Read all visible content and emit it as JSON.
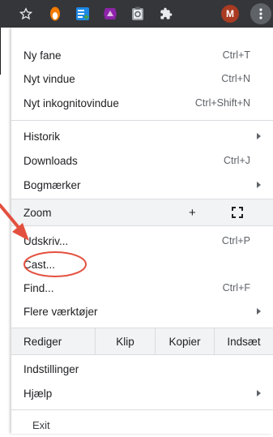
{
  "toolbar": {
    "icons": [
      "star-icon",
      "extension-orange-icon",
      "extension-list-icon",
      "extension-purple-icon",
      "extension-clipboard-icon",
      "extensions-puzzle-icon"
    ],
    "avatar": {
      "letter": "M",
      "color": "#a93b22"
    },
    "menu_button_icon": "kebab-menu-icon",
    "background": "#35363a"
  },
  "menu": {
    "group1": [
      {
        "label": "Ny fane",
        "shortcut": "Ctrl+T"
      },
      {
        "label": "Nyt vindue",
        "shortcut": "Ctrl+N"
      },
      {
        "label": "Nyt inkognitovindue",
        "shortcut": "Ctrl+Shift+N"
      }
    ],
    "group2": [
      {
        "label": "Historik",
        "shortcut": "",
        "submenu": true
      },
      {
        "label": "Downloads",
        "shortcut": "Ctrl+J"
      },
      {
        "label": "Bogmærker",
        "shortcut": "",
        "submenu": true
      }
    ],
    "zoom": {
      "label": "Zoom",
      "plus": "+",
      "fullscreen_icon": "fullscreen-icon"
    },
    "group3": [
      {
        "label": "Udskriv...",
        "shortcut": "Ctrl+P"
      },
      {
        "label": "Cast...",
        "shortcut": ""
      },
      {
        "label": "Find...",
        "shortcut": "Ctrl+F"
      },
      {
        "label": "Flere værktøjer",
        "shortcut": "",
        "submenu": true
      }
    ],
    "edit_row": [
      "Rediger",
      "Klip",
      "Kopier",
      "Indsæt"
    ],
    "group4": [
      {
        "label": "Indstillinger",
        "shortcut": ""
      },
      {
        "label": "Hjælp",
        "shortcut": "",
        "submenu": true
      }
    ],
    "exit": {
      "label": "Exit"
    }
  },
  "annotation": {
    "color": "#e4503f",
    "highlighted_item": "Cast..."
  }
}
